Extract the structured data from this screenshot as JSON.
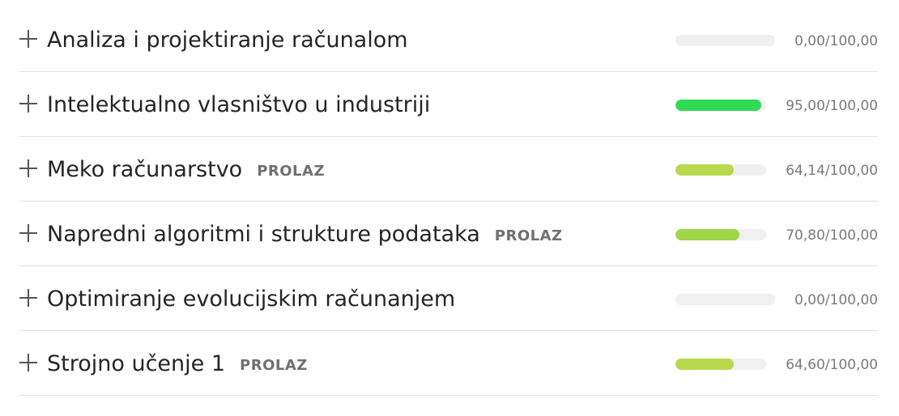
{
  "courses": [
    {
      "title": "Analiza i projektiranje računalom",
      "badge": "",
      "score": "0,00/100,00",
      "progress": 0.0,
      "color": "#f0f0f0",
      "bar_width": 123
    },
    {
      "title": "Intelektualno vlasništvo u industriji",
      "badge": "",
      "score": "95,00/100,00",
      "progress": 0.95,
      "color": "#32d955",
      "bar_width": 112
    },
    {
      "title": "Meko računarstvo",
      "badge": "PROLAZ",
      "score": "64,14/100,00",
      "progress": 0.6414,
      "color": "#b8d94e",
      "bar_width": 112
    },
    {
      "title": "Napredni algoritmi i strukture podataka",
      "badge": "PROLAZ",
      "score": "70,80/100,00",
      "progress": 0.708,
      "color": "#9fd64a",
      "bar_width": 112
    },
    {
      "title": "Optimiranje evolucijskim računanjem",
      "badge": "",
      "score": "0,00/100,00",
      "progress": 0.0,
      "color": "#f0f0f0",
      "bar_width": 123
    },
    {
      "title": "Strojno učenje 1",
      "badge": "PROLAZ",
      "score": "64,60/100,00",
      "progress": 0.646,
      "color": "#b8d94e",
      "bar_width": 112
    }
  ]
}
